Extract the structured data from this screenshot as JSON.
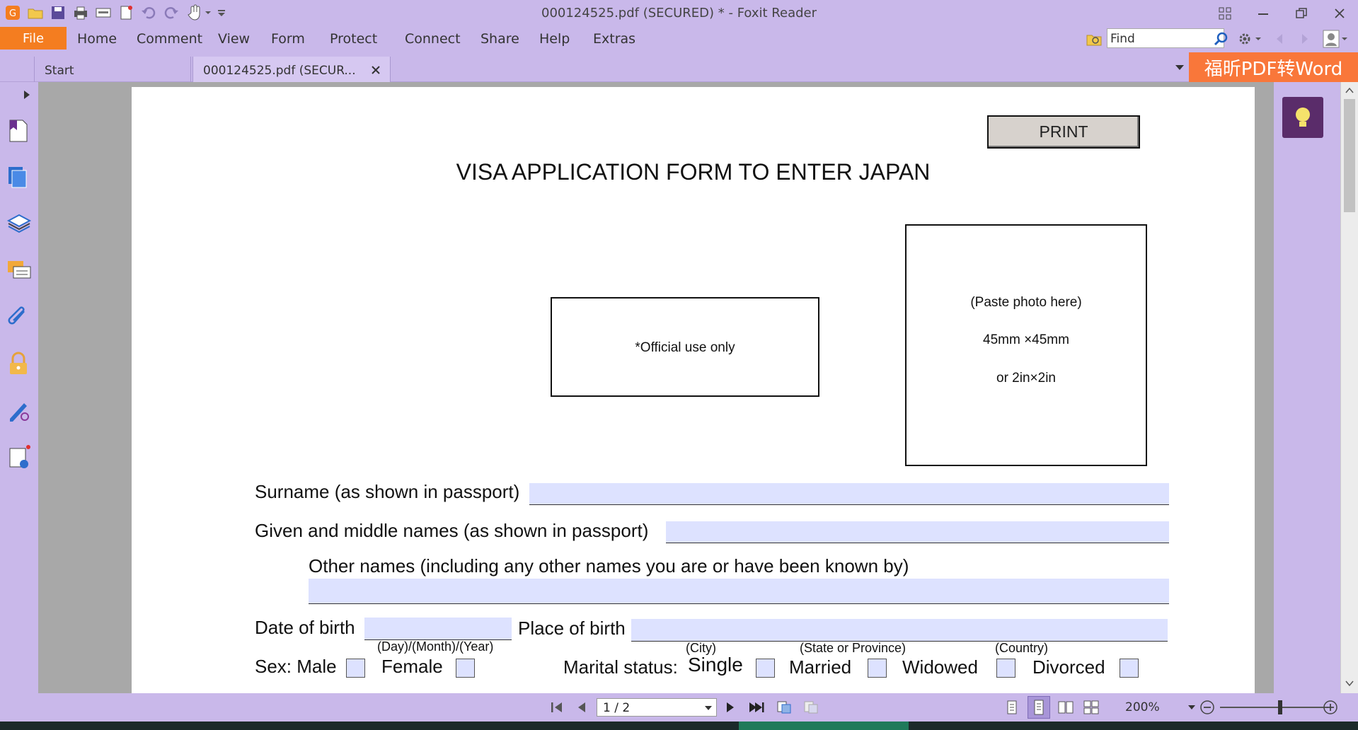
{
  "window": {
    "title": "000124525.pdf (SECURED) * - Foxit Reader"
  },
  "menu": {
    "file": "File",
    "items": [
      "Home",
      "Comment",
      "View",
      "Form",
      "Protect",
      "Connect",
      "Share",
      "Help",
      "Extras"
    ]
  },
  "search": {
    "placeholder": "Find"
  },
  "tabs": {
    "start": "Start",
    "doc": "000124525.pdf (SECUR..."
  },
  "promo": "福昕PDF转Word",
  "form": {
    "print": "PRINT",
    "title": "VISA APPLICATION FORM TO ENTER JAPAN",
    "official": "*Official use only",
    "photo_line1": "(Paste photo here)",
    "photo_line2": "45mm ×45mm",
    "photo_line3": "or 2in×2in",
    "surname": "Surname (as shown in passport)",
    "given": "Given and middle names (as shown in passport)",
    "other": "Other names (including any other names you are or have been known by)",
    "dob": "Date of birth",
    "dob_hint": "(Day)/(Month)/(Year)",
    "pob": "Place of birth",
    "city": "(City)",
    "state": "(State or Province)",
    "country": "(Country)",
    "sex": "Sex: Male",
    "female": "Female",
    "marital": "Marital status:",
    "single": "Single",
    "married": "Married",
    "widowed": "Widowed",
    "divorced": "Divorced"
  },
  "status": {
    "page": "1 / 2",
    "zoom": "200%"
  },
  "colors": {
    "chrome": "#c9b8ea",
    "accent": "#f47d20",
    "field": "#dde2ff"
  }
}
